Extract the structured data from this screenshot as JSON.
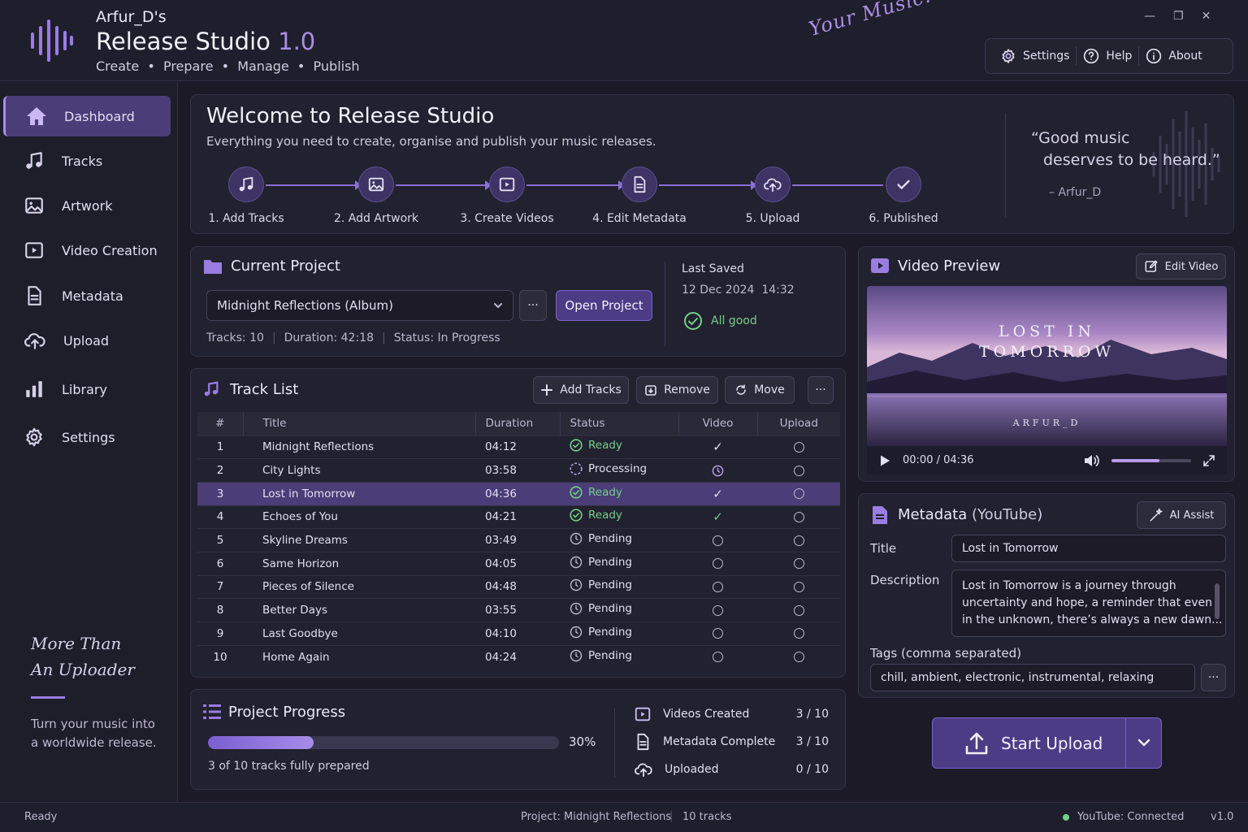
{
  "header": {
    "owner": "Arfur_D's",
    "app_name": "Release Studio",
    "app_version": "1.0",
    "tagline": "Create  •  Prepare  •  Manage  •  Publish",
    "slogan": "Your Music. Further.",
    "buttons": {
      "settings": "Settings",
      "help": "Help",
      "about": "About"
    }
  },
  "sidebar": {
    "items": [
      {
        "label": "Dashboard",
        "icon": "home-icon",
        "active": true
      },
      {
        "label": "Tracks",
        "icon": "music-note-icon"
      },
      {
        "label": "Artwork",
        "icon": "image-icon"
      },
      {
        "label": "Video Creation",
        "icon": "video-icon"
      },
      {
        "label": "Metadata",
        "icon": "document-icon"
      },
      {
        "label": "Upload",
        "icon": "cloud-upload-icon"
      },
      {
        "label": "Library",
        "icon": "bar-chart-icon"
      },
      {
        "label": "Settings",
        "icon": "gear-icon"
      }
    ],
    "quote_line1": "More Than",
    "quote_line2": "An Uploader",
    "text": "Turn your music into a worldwide release."
  },
  "welcome": {
    "title": "Welcome to Release Studio",
    "subtitle": "Everything you need to create, organise and publish your music releases.",
    "steps": [
      "1. Add Tracks",
      "2. Add Artwork",
      "3. Create Videos",
      "4. Edit Metadata",
      "5. Upload",
      "6. Published"
    ],
    "quote_line1": "“Good music",
    "quote_line2": "deserves to be heard.”",
    "quote_author": "– Arfur_D"
  },
  "project": {
    "title": "Current Project",
    "selected": "Midnight Reflections (Album)",
    "more": "···",
    "open_label": "Open Project",
    "tracks_label": "Tracks:",
    "tracks_value": "10",
    "duration_label": "Duration:",
    "duration_value": "42:18",
    "status_label": "Status:",
    "status_value": "In Progress",
    "last_saved_label": "Last Saved",
    "last_saved_date": "12 Dec 2024  14:32",
    "health": "All good"
  },
  "tracklist": {
    "title": "Track List",
    "add_label": "Add Tracks",
    "remove_label": "Remove",
    "move_label": "Move",
    "more": "···",
    "columns": [
      "#",
      "Title",
      "Duration",
      "Status",
      "Video",
      "Upload"
    ],
    "rows": [
      {
        "num": "1",
        "title": "Midnight Reflections",
        "duration": "04:12",
        "status": "Ready",
        "video": "check",
        "upload": "empty"
      },
      {
        "num": "2",
        "title": "City Lights",
        "duration": "03:58",
        "status": "Processing",
        "video": "clock",
        "upload": "empty"
      },
      {
        "num": "3",
        "title": "Lost in Tomorrow",
        "duration": "04:36",
        "status": "Ready",
        "video": "check",
        "upload": "empty",
        "selected": true
      },
      {
        "num": "4",
        "title": "Echoes of You",
        "duration": "04:21",
        "status": "Ready",
        "video": "check",
        "upload": "empty"
      },
      {
        "num": "5",
        "title": "Skyline Dreams",
        "duration": "03:49",
        "status": "Pending",
        "video": "empty",
        "upload": "empty"
      },
      {
        "num": "6",
        "title": "Same Horizon",
        "duration": "04:05",
        "status": "Pending",
        "video": "empty",
        "upload": "empty"
      },
      {
        "num": "7",
        "title": "Pieces of Silence",
        "duration": "04:48",
        "status": "Pending",
        "video": "empty",
        "upload": "empty"
      },
      {
        "num": "8",
        "title": "Better Days",
        "duration": "03:55",
        "status": "Pending",
        "video": "empty",
        "upload": "empty"
      },
      {
        "num": "9",
        "title": "Last Goodbye",
        "duration": "04:10",
        "status": "Pending",
        "video": "empty",
        "upload": "empty"
      },
      {
        "num": "10",
        "title": "Home Again",
        "duration": "04:24",
        "status": "Pending",
        "video": "empty",
        "upload": "empty"
      }
    ]
  },
  "progress": {
    "title": "Project Progress",
    "percent": 30,
    "percent_label": "30%",
    "summary": "3 of 10 tracks fully prepared",
    "stats": [
      {
        "label": "Videos Created",
        "value": "3 / 10",
        "icon": "video-icon"
      },
      {
        "label": "Metadata Complete",
        "value": "3 / 10",
        "icon": "document-icon"
      },
      {
        "label": "Uploaded",
        "value": "0 / 10",
        "icon": "cloud-upload-icon"
      }
    ]
  },
  "video": {
    "title": "Video Preview",
    "edit_label": "Edit Video",
    "overlay_line1": "LOST IN",
    "overlay_line2": "TOMORROW",
    "overlay_artist": "ARFUR_D",
    "time": "00:00 / 04:36",
    "playback_fraction": 0,
    "volume_fraction": 0.6
  },
  "metadata": {
    "title_main": "Metadata",
    "title_sub": "(YouTube)",
    "ai_label": "AI Assist",
    "title_label": "Title",
    "title_value": "Lost in Tomorrow",
    "desc_label": "Description",
    "desc_value": "Lost in Tomorrow is a journey through\nuncertainty and hope, a reminder that even\nin the unknown, there’s always a new dawn...",
    "tags_label": "Tags (comma separated)",
    "tags_value": "chill, ambient, electronic, instrumental, relaxing",
    "more": "···"
  },
  "upload": {
    "label": "Start Upload"
  },
  "statusbar": {
    "left": "Ready",
    "project": "Project: Midnight Reflections",
    "tracks": "10 tracks",
    "connection": "YouTube: Connected",
    "version": "v1.0"
  },
  "colors": {
    "accent": "#8a6fd6",
    "accent_dark": "#4c3c86",
    "ok": "#74cf8a",
    "bg": "#1b1a26"
  }
}
